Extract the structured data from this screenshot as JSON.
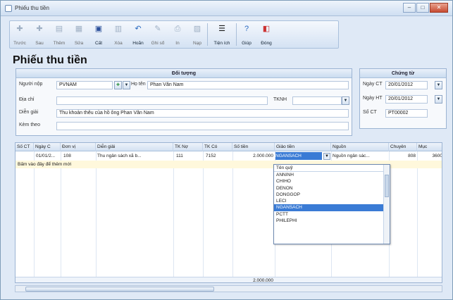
{
  "window": {
    "title": "Phiếu thu tiền"
  },
  "toolbar": [
    {
      "label": "Trước",
      "icon": "arrow-left-icon",
      "enabled": false
    },
    {
      "label": "Sau",
      "icon": "arrow-right-icon",
      "enabled": false
    },
    {
      "label": "Thêm",
      "icon": "add-icon",
      "enabled": false
    },
    {
      "label": "Sửa",
      "icon": "edit-icon",
      "enabled": false
    },
    {
      "label": "Cất",
      "icon": "save-icon",
      "enabled": true
    },
    {
      "label": "Xóa",
      "icon": "delete-icon",
      "enabled": false
    },
    {
      "label": "Hoãn",
      "icon": "undo-icon",
      "enabled": true
    },
    {
      "label": "Ghi sổ",
      "icon": "post-icon",
      "enabled": false
    },
    {
      "label": "In",
      "icon": "print-icon",
      "enabled": false
    },
    {
      "label": "Nạp",
      "icon": "reload-icon",
      "enabled": false
    },
    {
      "label": "Tiện ích",
      "icon": "utility-icon",
      "enabled": true
    },
    {
      "label": "Giúp",
      "icon": "help-icon",
      "enabled": true
    },
    {
      "label": "Đóng",
      "icon": "close-icon",
      "enabled": true
    }
  ],
  "page_title": "Phiếu thu tiền",
  "doituong": {
    "heading": "Đối tượng",
    "nguoi_nop_label": "Người nộp",
    "nguoi_nop": "PVNAM",
    "ho_ten_label": "Họ tên",
    "ho_ten": "Phan Văn Nam",
    "dia_chi_label": "Địa chỉ",
    "dia_chi": "",
    "tkno_label": "TKNH",
    "dien_giai_label": "Diễn giải",
    "dien_giai": "Thu khoản thêu của hồ ông Phan Văn Nam",
    "kem_theo_label": "Kèm theo",
    "kem_theo": ""
  },
  "chungtu": {
    "heading": "Chứng từ",
    "ngay_ct_label": "Ngày CT",
    "ngay_ct": "20/01/2012",
    "ngay_ht_label": "Ngày HT",
    "ngay_ht": "20/01/2012",
    "so_ct_label": "Số CT",
    "so_ct": "PT00002"
  },
  "grid": {
    "columns": [
      "Số CT",
      "Ngày C",
      "Đơn vị",
      "Diễn giải",
      "TK Nợ",
      "TK Có",
      "Số tiền",
      "Giảo tiền",
      "Nguồn",
      "Chuyên",
      "Mục"
    ],
    "rows": [
      [
        "",
        "01/01/2...",
        "108",
        "Thu ngân sách xã b...",
        "111",
        "7152",
        "2.000.000",
        "NGANSACH",
        "Nguồn ngân sác...",
        "808",
        "3600"
      ]
    ],
    "new_row_text": "Bấm vào đây để thêm mới",
    "total": "2.000.000"
  },
  "dropdown": {
    "header": "Tên quỹ",
    "items": [
      "ANNINH",
      "CHIHO",
      "DENON",
      "DONGGOP",
      "LECI",
      "NGANSACH",
      "PCTT",
      "PHILEPHI"
    ],
    "selected": "NGANSACH"
  }
}
